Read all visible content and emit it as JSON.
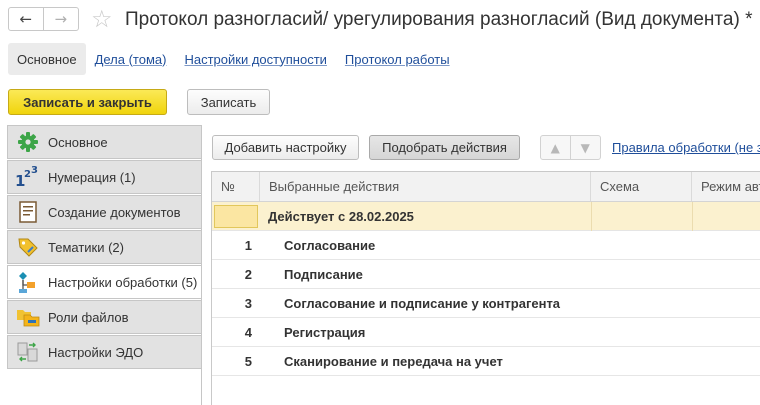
{
  "window": {
    "title": "Протокол разногласий/ урегулирования разногласий (Вид документа) *"
  },
  "top_tabs": [
    {
      "label": "Основное"
    },
    {
      "label": "Дела (тома)"
    },
    {
      "label": "Настройки доступности"
    },
    {
      "label": "Протокол работы"
    }
  ],
  "command_bar": {
    "save_close_label": "Записать и закрыть",
    "save_label": "Записать"
  },
  "sidebar": {
    "items": [
      {
        "label": "Основное",
        "icon": "gear-icon"
      },
      {
        "label": "Нумерация (1)",
        "icon": "numbering-icon"
      },
      {
        "label": "Создание документов",
        "icon": "document-icon"
      },
      {
        "label": "Тематики (2)",
        "icon": "tag-icon"
      },
      {
        "label": "Настройки обработки (5)",
        "icon": "workflow-icon"
      },
      {
        "label": "Роли файлов",
        "icon": "folders-icon"
      },
      {
        "label": "Настройки ЭДО",
        "icon": "edo-icon"
      }
    ]
  },
  "content": {
    "add_setting_label": "Добавить настройку",
    "pick_actions_label": "Подобрать действия",
    "rules_link": "Правила обработки (не з",
    "table": {
      "headers": [
        "№",
        "Выбранные действия",
        "Схема",
        "Режим авт"
      ],
      "group_label": "Действует с 28.02.2025",
      "rows": [
        {
          "num": "1",
          "action": "Согласование"
        },
        {
          "num": "2",
          "action": "Подписание"
        },
        {
          "num": "3",
          "action": "Согласование и подписание у контрагента"
        },
        {
          "num": "4",
          "action": "Регистрация"
        },
        {
          "num": "5",
          "action": "Сканирование и передача на учет"
        }
      ]
    }
  },
  "colors": {
    "primary_button": "#f2d622",
    "link": "#1f4e9a",
    "group_row": "#fbf1cf"
  }
}
